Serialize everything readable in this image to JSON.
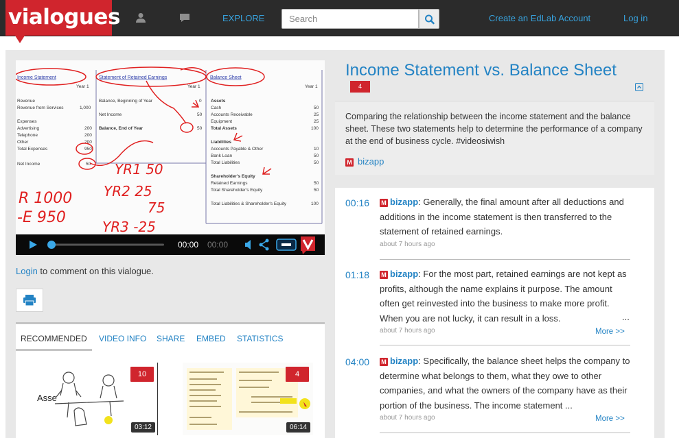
{
  "brand": {
    "logo_text": "vialogues",
    "accent": "#d0252d",
    "link": "#2383c4"
  },
  "nav": {
    "icons": [
      "user-icon",
      "chat-icon"
    ],
    "explore": "EXPLORE",
    "search_placeholder": "Search",
    "create_account": "Create an EdLab Account",
    "login": "Log in"
  },
  "player": {
    "current_time": "00:00",
    "duration": "00:00",
    "progress": 0,
    "icons": [
      "play-icon",
      "volume-icon",
      "share-icon",
      "captions-icon",
      "vialogues-logo-icon"
    ]
  },
  "comment_prompt": {
    "login": "Login",
    "rest": " to comment on this vialogue."
  },
  "tabs": [
    "RECOMMENDED",
    "VIDEO INFO",
    "SHARE",
    "EMBED",
    "STATISTICS"
  ],
  "recommended": [
    {
      "count": "10",
      "duration": "03:12"
    },
    {
      "count": "4",
      "duration": "06:14"
    }
  ],
  "vialogue": {
    "title": "Income Statement vs. Balance Sheet",
    "comment_count": "4",
    "description": "Comparing the relationship between the income statement and the balance sheet. These two statements help to determine the performance of a company at the end of business cycle. #videosiwish",
    "author": "bizapp",
    "author_badge": "M"
  },
  "comments": [
    {
      "time": "00:16",
      "author": "bizapp",
      "text": "Generally, the final amount after all deductions and additions in the income statement is then transferred to the statement of retained earnings.",
      "ago": "about 7 hours ago"
    },
    {
      "time": "01:18",
      "author": "bizapp",
      "text": "For the most part, retained earnings are not kept as profits, although the name explains it purpose. The amount often get reinvested into the business to make more profit. When you are not lucky, it can result in a loss.",
      "ellipsis": "...",
      "ago": "about 7 hours ago",
      "more": "More >>"
    },
    {
      "time": "04:00",
      "author": "bizapp",
      "text": "Specifically, the balance sheet helps the company to determine what belongs to them, what they owe to other companies, and what the owners of the company have as their portion of the business. The income statement ...",
      "ago": "about 7 hours ago",
      "more": "More >>"
    }
  ],
  "video_sheet": {
    "income": {
      "header": "Income Statement",
      "year": "Year 1",
      "rows": [
        [
          "Revenue",
          ""
        ],
        [
          "Revenue from Services",
          "1,000"
        ],
        [
          "Expenses",
          ""
        ],
        [
          "Advertising",
          "200"
        ],
        [
          "Telephone",
          "200"
        ],
        [
          "Other",
          "200"
        ],
        [
          "Total Expenses",
          "950"
        ],
        [
          "Net Income",
          "50"
        ]
      ]
    },
    "retained": {
      "header": "Statement of Retained Earnings",
      "year": "Year 1",
      "rows": [
        [
          "Balance, Beginning of Year",
          "0"
        ],
        [
          "Net Income",
          "50"
        ],
        [
          "Balance, End of Year",
          "50"
        ]
      ]
    },
    "balance": {
      "header": "Balance Sheet",
      "year": "Year 1",
      "rows": [
        [
          "Assets",
          ""
        ],
        [
          "Cash",
          "50"
        ],
        [
          "Accounts Receivable",
          "25"
        ],
        [
          "Equipment",
          "25"
        ],
        [
          "Total Assets",
          "100"
        ],
        [
          "Liabilities",
          ""
        ],
        [
          "Accounts Payable & Other",
          "10"
        ],
        [
          "Bank Loan",
          "50"
        ],
        [
          "Total Liabilities",
          "50"
        ],
        [
          "Shareholder's Equity",
          ""
        ],
        [
          "Retained Earnings",
          "50"
        ],
        [
          "Total Shareholder's Equity",
          "50"
        ],
        [
          "Total Liabilities & Shareholder's Equity",
          "100"
        ]
      ]
    },
    "handwriting": [
      "R 1000",
      "-E 950",
      "YR1 50",
      "YR2 25",
      "75",
      "YR3 -25"
    ]
  }
}
